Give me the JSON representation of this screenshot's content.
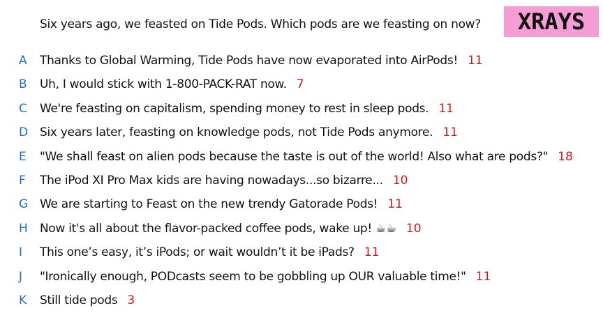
{
  "question": "Six years ago, we feasted on Tide Pods. Which pods are we feasting on now?",
  "logo": "XRAYS",
  "colors": {
    "logo_bg": "#f59ed6",
    "letter": "#1f6fd0",
    "count": "#c8171f"
  },
  "answers": [
    {
      "letter": "A",
      "text": "Thanks to Global Warming, Tide Pods have now evaporated into AirPods!",
      "count": "11"
    },
    {
      "letter": "B",
      "text": "Uh, I would stick with 1-800-PACK-RAT now.",
      "count": "7"
    },
    {
      "letter": "C",
      "text": "We're feasting on capitalism, spending money to rest in sleep pods.",
      "count": "11"
    },
    {
      "letter": "D",
      "text": "Six years later, feasting on knowledge pods, not Tide Pods anymore.",
      "count": "11"
    },
    {
      "letter": "E",
      "text": "\"We shall feast on alien pods because the taste is out of the world! Also what are pods?\"",
      "count": "18"
    },
    {
      "letter": "F",
      "text": "The iPod XI Pro Max kids are having nowadays...so bizarre...",
      "count": "10"
    },
    {
      "letter": "G",
      "text": "We are starting to Feast on the new trendy Gatorade Pods!",
      "count": "11"
    },
    {
      "letter": "H",
      "text": "Now it's all about the flavor-packed coffee pods, wake up! ☕☕",
      "count": "10"
    },
    {
      "letter": "I",
      "text": "This one’s easy, it’s iPods; or wait wouldn’t it be iPads?",
      "count": "11"
    },
    {
      "letter": "J",
      "text": "\"Ironically enough, PODcasts seem to be gobbling up OUR valuable time!\"",
      "count": "11"
    },
    {
      "letter": "K",
      "text": "Still tide pods",
      "count": "3"
    }
  ]
}
